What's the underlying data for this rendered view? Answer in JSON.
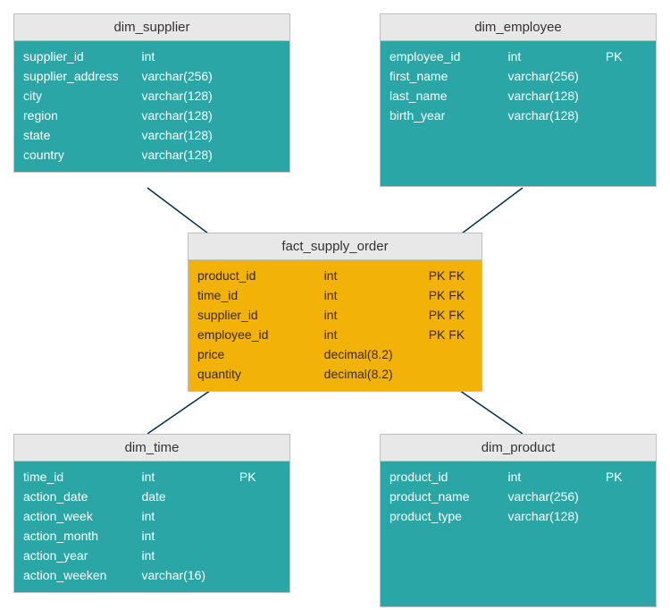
{
  "colors": {
    "teal": "#2aa6a6",
    "gold": "#f2b207",
    "header_bg": "#e8e8e8",
    "border": "#bfbfbf",
    "connector": "#00304d"
  },
  "entities": {
    "dim_supplier": {
      "title": "dim_supplier",
      "theme": "teal",
      "columns": [
        {
          "name": "supplier_id",
          "type": "int",
          "key": ""
        },
        {
          "name": "supplier_address",
          "type": "varchar(256)",
          "key": ""
        },
        {
          "name": "city",
          "type": "varchar(128)",
          "key": ""
        },
        {
          "name": "region",
          "type": "varchar(128)",
          "key": ""
        },
        {
          "name": "state",
          "type": "varchar(128)",
          "key": ""
        },
        {
          "name": "country",
          "type": "varchar(128)",
          "key": ""
        }
      ]
    },
    "dim_employee": {
      "title": "dim_employee",
      "theme": "teal",
      "columns": [
        {
          "name": "employee_id",
          "type": "int",
          "key": "PK"
        },
        {
          "name": "first_name",
          "type": "varchar(256)",
          "key": ""
        },
        {
          "name": "last_name",
          "type": "varchar(128)",
          "key": ""
        },
        {
          "name": "birth_year",
          "type": "varchar(128)",
          "key": ""
        }
      ]
    },
    "fact_supply_order": {
      "title": "fact_supply_order",
      "theme": "gold",
      "columns": [
        {
          "name": "product_id",
          "type": "int",
          "key": "PK FK"
        },
        {
          "name": "time_id",
          "type": "int",
          "key": "PK FK"
        },
        {
          "name": "supplier_id",
          "type": "int",
          "key": "PK FK"
        },
        {
          "name": "employee_id",
          "type": "int",
          "key": "PK FK"
        },
        {
          "name": "price",
          "type": "decimal(8.2)",
          "key": ""
        },
        {
          "name": "quantity",
          "type": "decimal(8.2)",
          "key": ""
        }
      ]
    },
    "dim_time": {
      "title": "dim_time",
      "theme": "teal",
      "columns": [
        {
          "name": "time_id",
          "type": "int",
          "key": "PK"
        },
        {
          "name": "action_date",
          "type": "date",
          "key": ""
        },
        {
          "name": "action_week",
          "type": "int",
          "key": ""
        },
        {
          "name": "action_month",
          "type": "int",
          "key": ""
        },
        {
          "name": "action_year",
          "type": "int",
          "key": ""
        },
        {
          "name": "action_weeken",
          "type": "varchar(16)",
          "key": ""
        }
      ]
    },
    "dim_product": {
      "title": "dim_product",
      "theme": "teal",
      "columns": [
        {
          "name": "product_id",
          "type": "int",
          "key": "PK"
        },
        {
          "name": "product_name",
          "type": "varchar(256)",
          "key": ""
        },
        {
          "name": "product_type",
          "type": "varchar(128)",
          "key": ""
        }
      ]
    }
  },
  "connectors": [
    {
      "from": "dim_supplier",
      "to": "fact_supply_order"
    },
    {
      "from": "dim_employee",
      "to": "fact_supply_order"
    },
    {
      "from": "dim_time",
      "to": "fact_supply_order"
    },
    {
      "from": "dim_product",
      "to": "fact_supply_order"
    }
  ]
}
